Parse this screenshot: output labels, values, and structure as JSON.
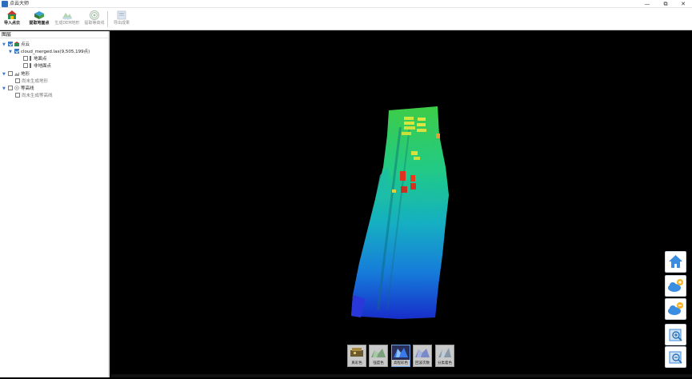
{
  "window": {
    "title": "点云大师",
    "controls": {
      "minimize": "—",
      "restore": "⧉",
      "close": "✕"
    }
  },
  "toolbar": {
    "items": [
      {
        "label": "导入点云",
        "icon": "import-pointcloud-icon",
        "state": "active"
      },
      {
        "label": "提取地面点",
        "icon": "extract-ground-icon",
        "state": "active"
      },
      {
        "label": "生成DEM地形",
        "icon": "generate-dem-icon",
        "state": "disabled"
      },
      {
        "label": "提取等高线",
        "icon": "extract-contour-icon",
        "state": "disabled"
      },
      {
        "label": "导出成果",
        "icon": "export-result-icon",
        "state": "disabled"
      }
    ]
  },
  "layers_panel": {
    "title": "图层",
    "tree": [
      {
        "label": "点云",
        "level": 0,
        "expanded": true,
        "checked": true,
        "icon": "pointcloud-layer-icon"
      },
      {
        "label": "cloud_merged.las(9,505,199点)",
        "level": 1,
        "expanded": true,
        "checked": true
      },
      {
        "label": "地面点",
        "level": 2,
        "checked": false
      },
      {
        "label": "非地面点",
        "level": 2,
        "checked": false
      },
      {
        "label": "地形",
        "level": 0,
        "expanded": true,
        "checked": false,
        "icon": "terrain-layer-icon"
      },
      {
        "label": "尚未生成地形",
        "level": 1,
        "checked": false
      },
      {
        "label": "等高线",
        "level": 0,
        "expanded": true,
        "checked": false,
        "icon": "contour-layer-icon"
      },
      {
        "label": "尚未生成等高线",
        "level": 1,
        "checked": false
      }
    ]
  },
  "side_tools": [
    {
      "icon": "home-view-icon"
    },
    {
      "icon": "cloud-add-icon"
    },
    {
      "icon": "cloud-remove-icon"
    },
    {
      "icon": "zoom-in-icon"
    },
    {
      "icon": "zoom-out-icon"
    }
  ],
  "render_modes": [
    {
      "label": "真彩色",
      "icon": "true-color-icon",
      "selected": false
    },
    {
      "label": "强度色",
      "icon": "intensity-color-icon",
      "selected": false
    },
    {
      "label": "高程彩色",
      "icon": "elevation-color-icon",
      "selected": true
    },
    {
      "label": "回波次数",
      "icon": "return-number-icon",
      "selected": false
    },
    {
      "label": "分类着色",
      "icon": "classification-color-icon",
      "selected": false
    }
  ],
  "colors": {
    "selected_border": "#6aa0e8",
    "tree_accent": "#3a78c8",
    "elevation_low": "#1a2fd0",
    "elevation_mid": "#20d27a",
    "elevation_high": "#d81818"
  }
}
